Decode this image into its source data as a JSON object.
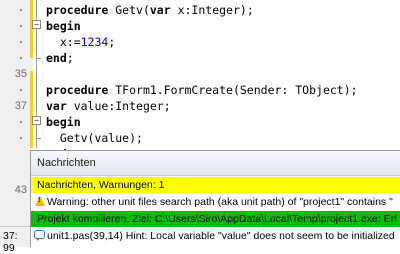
{
  "editor": {
    "lines": [
      {
        "num": "",
        "tokens": [
          {
            "t": "procedure ",
            "c": "kw"
          },
          {
            "t": "Getv(",
            "c": "tx"
          },
          {
            "t": "var",
            "c": "kw"
          },
          {
            "t": " x:Integer);",
            "c": "tx"
          }
        ]
      },
      {
        "num": "",
        "tokens": [
          {
            "t": "begin",
            "c": "kw"
          }
        ]
      },
      {
        "num": "",
        "tokens": [
          {
            "t": "  x:=",
            "c": "tx"
          },
          {
            "t": "1234",
            "c": "num-lit"
          },
          {
            "t": ";",
            "c": "tx"
          }
        ]
      },
      {
        "num": "",
        "tokens": [
          {
            "t": "end",
            "c": "kw"
          },
          {
            "t": ";",
            "c": "tx"
          }
        ]
      },
      {
        "num": "35",
        "tokens": []
      },
      {
        "num": "",
        "tokens": [
          {
            "t": "procedure ",
            "c": "kw"
          },
          {
            "t": "TForm1.FormCreate(Sender: TObject);",
            "c": "tx"
          }
        ]
      },
      {
        "num": "37",
        "tokens": [
          {
            "t": "var",
            "c": "kw"
          },
          {
            "t": " value:Integer;",
            "c": "tx"
          }
        ]
      },
      {
        "num": "",
        "tokens": [
          {
            "t": "begin",
            "c": "kw"
          }
        ]
      },
      {
        "num": "",
        "tokens": [
          {
            "t": "  Getv(value);",
            "c": "tx"
          }
        ]
      },
      {
        "num": "40",
        "tokens": [
          {
            "t": "end",
            "c": "kw"
          },
          {
            "t": ";",
            "c": "tx"
          }
        ]
      }
    ],
    "hidden_line_num": "43"
  },
  "messages": {
    "title": "Nachrichten",
    "header_row": "Nachrichten, Warnungen: 1",
    "warning_row": "Warning: other unit files search path (aka unit path) of \"project1\" contains \"",
    "compile_row": "Projekt kompilieren, Ziel: C:\\Users\\Siro\\AppData\\Local\\Temp\\project1.exe: Erf",
    "hint_row": "unit1.pas(39,14) Hint: Local variable \"value\" does not seem to be initialized"
  },
  "statusbar": {
    "position": "37: 99"
  },
  "colors": {
    "header_bg": "#ffff00",
    "compile_bg": "#00c000",
    "change_marker": "#f2cf2b"
  }
}
